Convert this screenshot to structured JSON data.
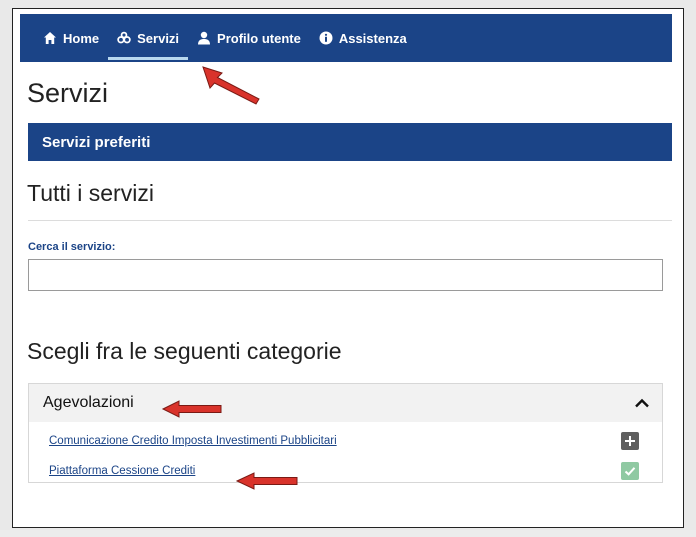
{
  "nav": {
    "items": [
      {
        "label": "Home",
        "icon": "home-icon"
      },
      {
        "label": "Servizi",
        "icon": "services-icon"
      },
      {
        "label": "Profilo utente",
        "icon": "user-icon"
      },
      {
        "label": "Assistenza",
        "icon": "info-icon"
      }
    ],
    "active_index": 1
  },
  "page": {
    "title": "Servizi",
    "favorites_label": "Servizi preferiti",
    "all_services_title": "Tutti i servizi",
    "search": {
      "label": "Cerca il servizio:",
      "value": "",
      "placeholder": ""
    },
    "categories_title": "Scegli fra le seguenti categorie"
  },
  "accordion": {
    "title": "Agevolazioni",
    "expanded": true,
    "items": [
      {
        "label": "Comunicazione Credito Imposta Investimenti Pubblicitari",
        "action": "add"
      },
      {
        "label": "Piattaforma Cessione Crediti",
        "action": "favorite"
      }
    ]
  },
  "colors": {
    "nav_bg": "#1b4487",
    "active_underline": "#b8d8ef",
    "link": "#1b4487",
    "annotation_arrow": "#d9332b",
    "favorite_check": "#8fc9a2",
    "add_button": "#5f5f5f"
  }
}
